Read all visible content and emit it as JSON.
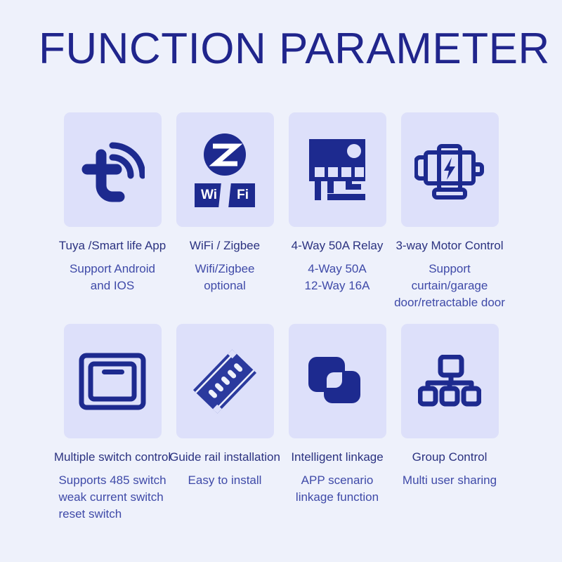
{
  "page": {
    "title": "FUNCTION PARAMETER",
    "background_color": "#eef1fb",
    "card_color": "#dde0fa",
    "accent_color": "#20258c",
    "heading_color": "#2b3280",
    "body_color": "#3f4aa8"
  },
  "features": [
    {
      "icon": "tuya-logo-icon",
      "heading": "Tuya /Smart life App",
      "body": "Support Android\nand IOS",
      "body_align": "center"
    },
    {
      "icon": "zigbee-wifi-icon",
      "heading": "WiFi / Zigbee",
      "body": "Wifi/Zigbee\noptional",
      "body_align": "center",
      "wifi_badge": {
        "left": "Wi",
        "right": "Fi"
      }
    },
    {
      "icon": "relay-board-icon",
      "heading": "4-Way 50A Relay",
      "body": "4-Way 50A\n12-Way 16A",
      "body_align": "center"
    },
    {
      "icon": "electric-motor-icon",
      "heading": "3-way Motor Control",
      "body": "Support curtain/garage\ndoor/retractable door",
      "body_align": "center"
    },
    {
      "icon": "wall-switch-icon",
      "heading": "Multiple switch control",
      "body": "Supports 485 switch\nweak current switch\nreset switch",
      "body_align": "left"
    },
    {
      "icon": "din-rail-icon",
      "heading": "Guide rail installation",
      "body": "Easy to install",
      "body_align": "center"
    },
    {
      "icon": "linkage-squares-icon",
      "heading": "Intelligent linkage",
      "body": "APP scenario\nlinkage function",
      "body_align": "center"
    },
    {
      "icon": "hierarchy-group-icon",
      "heading": "Group Control",
      "body": "Multi user sharing",
      "body_align": "center"
    }
  ]
}
